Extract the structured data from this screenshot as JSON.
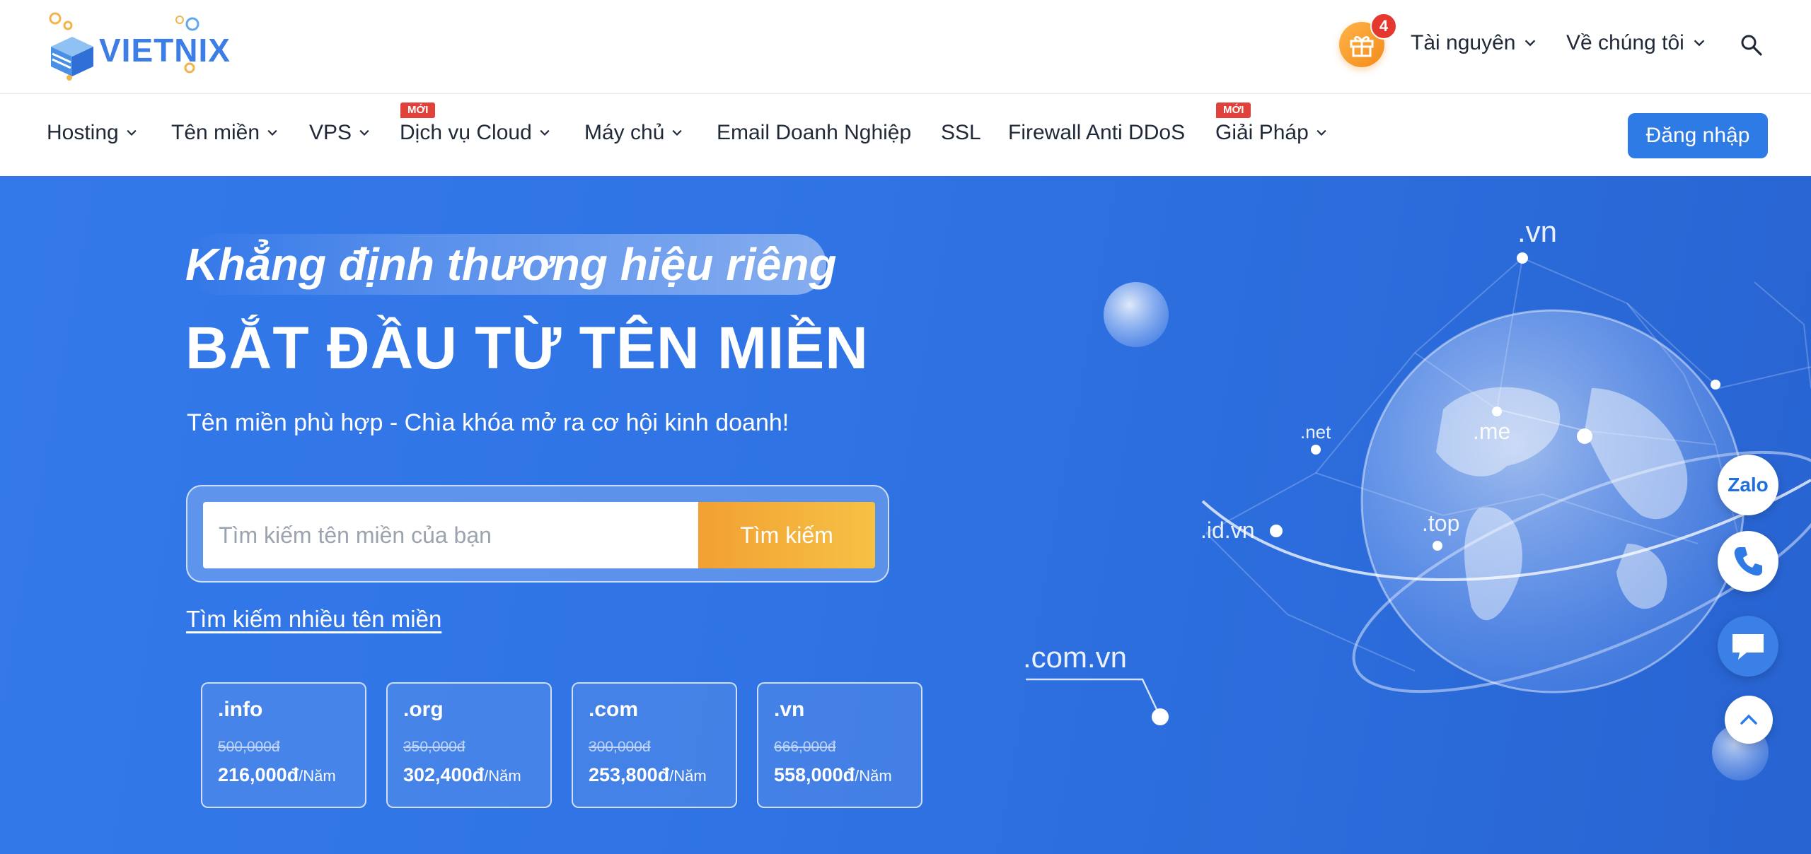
{
  "brand": {
    "logo_text": "VIETNIX"
  },
  "top_bar": {
    "gift_count": "4",
    "links": [
      "Tài nguyên",
      "Về chúng tôi"
    ]
  },
  "nav": {
    "items": [
      {
        "label": "Hosting",
        "dropdown": true
      },
      {
        "label": "Tên miền",
        "dropdown": true
      },
      {
        "label": "VPS",
        "dropdown": true
      },
      {
        "label": "Dịch vụ Cloud",
        "dropdown": true,
        "badge": "MỚI"
      },
      {
        "label": "Máy chủ",
        "dropdown": true
      },
      {
        "label": "Email Doanh Nghiệp",
        "dropdown": false
      },
      {
        "label": "SSL",
        "dropdown": false
      },
      {
        "label": "Firewall Anti DDoS",
        "dropdown": false
      },
      {
        "label": "Giải Pháp",
        "dropdown": true,
        "badge": "MỚI"
      }
    ],
    "login_label": "Đăng nhập"
  },
  "hero": {
    "tagline": "Khẳng định thương hiệu riêng",
    "headline": "BẮT ĐẦU TỪ TÊN MIỀN",
    "subtitle": "Tên miền phù hợp - Chìa khóa mở ra cơ hội kinh doanh!",
    "search_placeholder": "Tìm kiếm tên miền của bạn",
    "search_button": "Tìm kiếm",
    "multi_search_link": "Tìm kiếm nhiều tên miền",
    "domain_prices": [
      {
        "ext": ".info",
        "old": "500,000đ",
        "new": "216,000đ",
        "unit": "/Năm"
      },
      {
        "ext": ".org",
        "old": "350,000đ",
        "new": "302,400đ",
        "unit": "/Năm"
      },
      {
        "ext": ".com",
        "old": "300,000đ",
        "new": "253,800đ",
        "unit": "/Năm"
      },
      {
        "ext": ".vn",
        "old": "666,000đ",
        "new": "558,000đ",
        "unit": "/Năm"
      }
    ],
    "globe_labels": [
      ".vn",
      ".net",
      ".me",
      ".id.vn",
      ".top",
      ".com.vn"
    ]
  },
  "floating": {
    "zalo_label": "Zalo"
  },
  "colors": {
    "accent": "#2f7be6",
    "hero_bg": "#3479ea",
    "search_button": "#f2a032",
    "badge_red": "#e0413b"
  }
}
